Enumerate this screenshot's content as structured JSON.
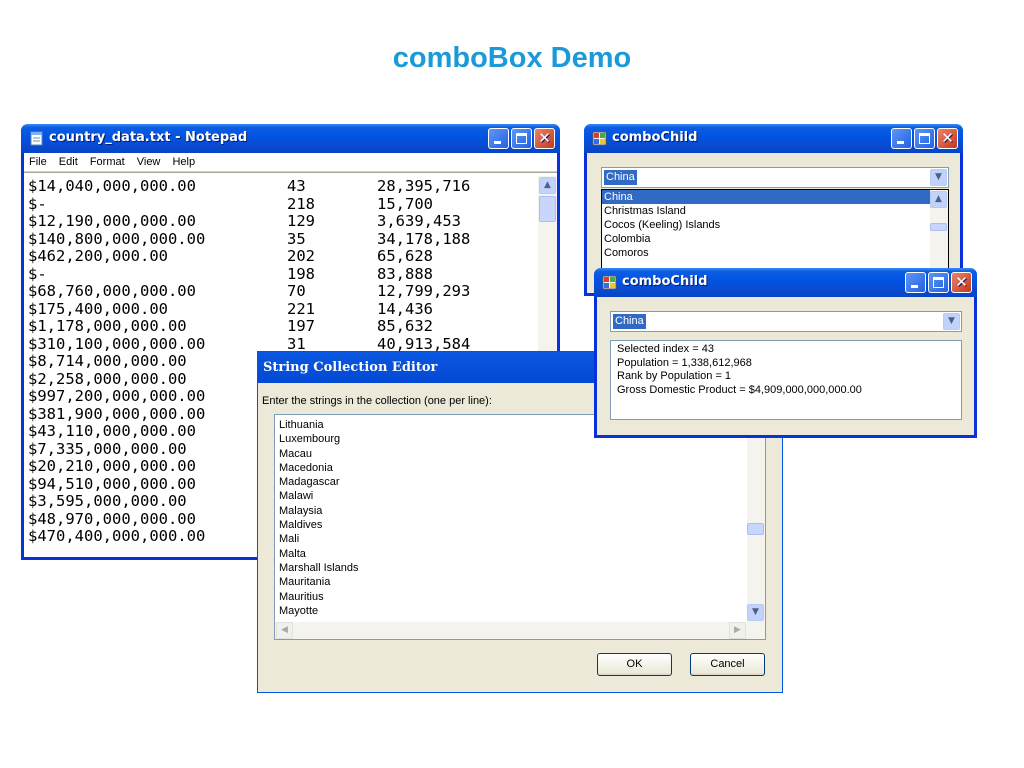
{
  "slide": {
    "title": "comboBox Demo"
  },
  "notepad": {
    "title": "country_data.txt - Notepad",
    "menu": [
      "File",
      "Edit",
      "Format",
      "View",
      "Help"
    ],
    "rows": [
      [
        "$14,040,000,000.00",
        "43",
        "28,395,716"
      ],
      [
        "$-",
        "218",
        "15,700"
      ],
      [
        "$12,190,000,000.00",
        "129",
        "3,639,453"
      ],
      [
        "$140,800,000,000.00",
        "35",
        "34,178,188"
      ],
      [
        "$462,200,000.00",
        "202",
        "65,628"
      ],
      [
        "$-",
        "198",
        "83,888"
      ],
      [
        "$68,760,000,000.00",
        "70",
        "12,799,293"
      ],
      [
        "$175,400,000.00",
        "221",
        "14,436"
      ],
      [
        "$1,178,000,000.00",
        "197",
        "85,632"
      ],
      [
        "$310,100,000,000.00",
        "31",
        "40,913,584"
      ],
      [
        "$8,714,000,000.00",
        "",
        ""
      ],
      [
        "$2,258,000,000.00",
        "",
        ""
      ],
      [
        "$997,200,000,000.00",
        "",
        ""
      ],
      [
        "$381,900,000,000.00",
        "",
        ""
      ],
      [
        "$43,110,000,000.00",
        "",
        ""
      ],
      [
        "$7,335,000,000.00",
        "",
        ""
      ],
      [
        "$20,210,000,000.00",
        "",
        ""
      ],
      [
        "$94,510,000,000.00",
        "",
        ""
      ],
      [
        "$3,595,000,000.00",
        "",
        ""
      ],
      [
        "$48,970,000,000.00",
        "",
        ""
      ],
      [
        "$470,400,000,000.00",
        "",
        ""
      ]
    ]
  },
  "string_editor": {
    "title": "String Collection Editor",
    "prompt": "Enter the strings in the collection (one per line):",
    "items": [
      "Lithuania",
      "Luxembourg",
      "Macau",
      "Macedonia",
      "Madagascar",
      "Malawi",
      "Malaysia",
      "Maldives",
      "Mali",
      "Malta",
      "Marshall Islands",
      "Mauritania",
      "Mauritius",
      "Mayotte"
    ],
    "ok_label": "OK",
    "cancel_label": "Cancel"
  },
  "combo_child_1": {
    "title": "comboChild",
    "selected": "China",
    "dropdown_items": [
      "China",
      "Christmas Island",
      "Cocos (Keeling) Islands",
      "Colombia",
      "Comoros"
    ]
  },
  "combo_child_2": {
    "title": "comboChild",
    "selected": "China",
    "info": {
      "line1": "Selected index = 43",
      "line2": "Population = 1,338,612,968",
      "line3": "Rank by Population = 1",
      "line4": "Gross Domestic Product = $4,909,000,000,000.00"
    }
  },
  "icons": {
    "notepad_icon": "notepad-icon",
    "app_icon": "app-icon",
    "minimize": "minimize-icon",
    "maximize": "maximize-icon",
    "close": "close-icon",
    "scroll_up": "scroll-up-icon",
    "scroll_down": "scroll-down-icon",
    "scroll_left": "scroll-left-icon",
    "scroll_right": "scroll-right-icon",
    "dropdown": "chevron-down-icon"
  }
}
